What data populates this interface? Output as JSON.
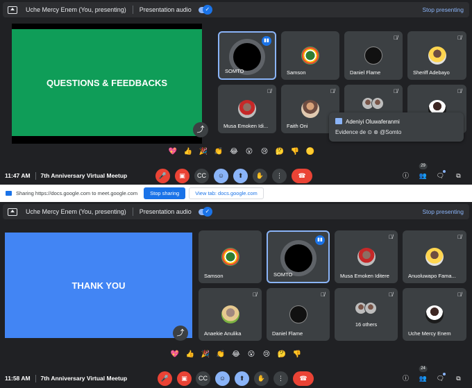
{
  "colors": {
    "slide1": "#0f9d58",
    "slide2": "#4285f4",
    "accent": "#8ab4f8",
    "end_call": "#ea4335"
  },
  "screen1": {
    "presenter_label": "Uche Mercy Enem (You, presenting)",
    "audio_label": "Presentation audio",
    "stop_label": "Stop presenting",
    "slide_text": "QUESTIONS & FEEDBACKS",
    "tiles": [
      {
        "name": "SOMTO"
      },
      {
        "name": "Samson"
      },
      {
        "name": "Daniel Flame"
      },
      {
        "name": "Sheriff Adebayo"
      },
      {
        "name": "Musa Emoken Idi..."
      },
      {
        "name": "Faith Oni"
      }
    ],
    "popup": {
      "sender": "Adeniyi Oluwaferanmi",
      "message": "Evidence de",
      "mention": "@Somto"
    },
    "reactions": [
      "💖",
      "👍",
      "🎉",
      "👏",
      "😂",
      "😮",
      "😢",
      "🤔",
      "👎",
      "🟡"
    ],
    "time": "11:47 AM",
    "meeting_title": "7th Anniversary Virtual Meetup",
    "participants_count": "29"
  },
  "share_strip": {
    "message": "Sharing https://docs.google.com to meet.google.com",
    "stop_button": "Stop sharing",
    "view_button": "View tab: docs.google.com"
  },
  "screen2": {
    "presenter_label": "Uche Mercy Enem (You, presenting)",
    "audio_label": "Presentation audio",
    "stop_label": "Stop presenting",
    "slide_text": "THANK YOU",
    "tiles": [
      {
        "name": "Samson"
      },
      {
        "name": "SOMTO"
      },
      {
        "name": "Musa Emoken Iditere"
      },
      {
        "name": "Anuoluwapo Fama..."
      },
      {
        "name": "Anaekie Anulika"
      },
      {
        "name": "Daniel Flame"
      },
      {
        "name": "16 others"
      },
      {
        "name": "Uche Mercy Enem"
      }
    ],
    "reactions": [
      "💖",
      "👍",
      "🎉",
      "👏",
      "😂",
      "😮",
      "😢",
      "🤔",
      "👎"
    ],
    "time": "11:58 AM",
    "meeting_title": "7th Anniversary Virtual Meetup",
    "participants_count": "24"
  },
  "icons": {
    "mic_off": "mic-off-icon",
    "cam_off": "camera-off-icon",
    "captions": "captions-icon",
    "emoji": "emoji-icon",
    "present": "present-icon",
    "hand": "raise-hand-icon",
    "more": "more-icon",
    "end": "end-call-icon",
    "info": "info-icon",
    "people": "people-icon",
    "chat": "chat-icon",
    "activities": "activities-icon"
  }
}
